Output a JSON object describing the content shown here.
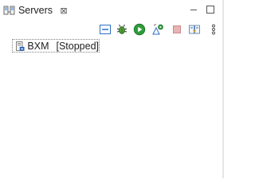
{
  "tab": {
    "label": "Servers",
    "icon": "servers-icon",
    "close_glyph": "⊠"
  },
  "window_controls": {
    "minimize_icon": "minimize-icon",
    "maximize_icon": "maximize-icon"
  },
  "toolbar": {
    "items": [
      {
        "name": "collapse-all",
        "icon": "collapse-icon"
      },
      {
        "name": "debug-server",
        "icon": "bug-icon"
      },
      {
        "name": "start-server",
        "icon": "play-icon"
      },
      {
        "name": "profile-server",
        "icon": "profile-icon"
      },
      {
        "name": "stop-server",
        "icon": "stop-icon"
      },
      {
        "name": "publish-server",
        "icon": "publish-icon"
      },
      {
        "name": "view-menu",
        "icon": "kebab-icon"
      }
    ]
  },
  "servers": [
    {
      "name": "BXM",
      "state": "[Stopped]"
    }
  ],
  "colors": {
    "accent_blue": "#2f6fc7",
    "play_green": "#2e9c3a",
    "stop_red": "#c85050"
  }
}
